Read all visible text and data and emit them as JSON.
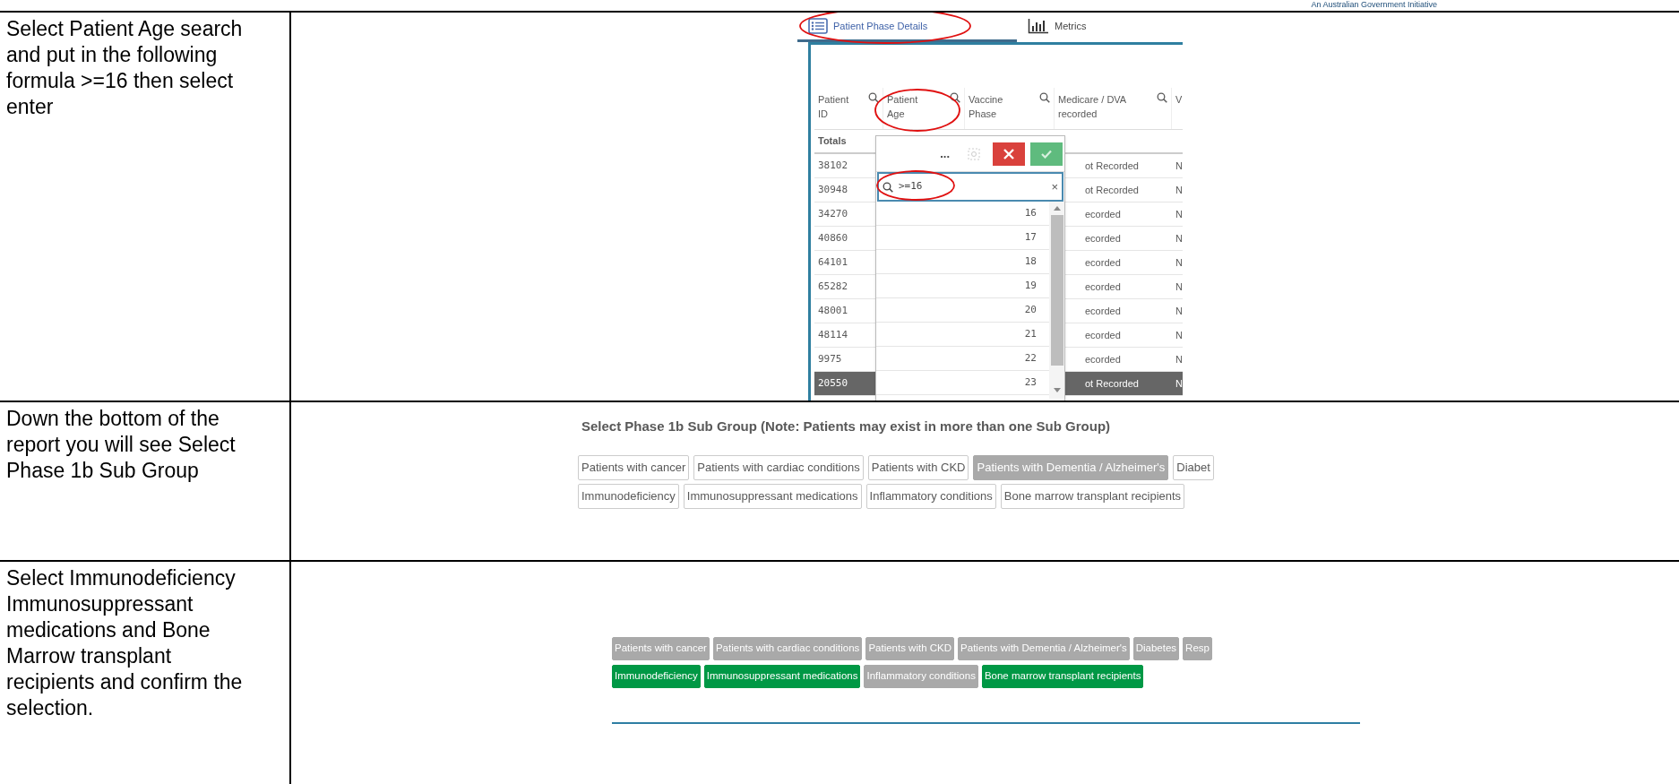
{
  "header_text": "An Australian Government Initiative",
  "steps": [
    {
      "instruction": "Select Patient Age search and put in the following formula >=16 then select enter",
      "screen": {
        "kind": "table_filter",
        "tabs": [
          {
            "label": "Patient Phase Details",
            "selected": true
          },
          {
            "label": "Metrics",
            "selected": false
          }
        ],
        "columns": [
          "Patient ID",
          "Patient Age",
          "Vaccine Phase",
          "Medicare / DVA recorded",
          "V"
        ],
        "totals_label": "Totals",
        "rows": [
          {
            "id": "38102",
            "column_4": "ot Recorded",
            "column_5": "N",
            "selected": false
          },
          {
            "id": "30948",
            "column_4": "ot Recorded",
            "column_5": "N",
            "selected": false
          },
          {
            "id": "34270",
            "column_4": "ecorded",
            "column_5": "N",
            "selected": false
          },
          {
            "id": "40860",
            "column_4": "ecorded",
            "column_5": "N",
            "selected": false
          },
          {
            "id": "64101",
            "column_4": "ecorded",
            "column_5": "N",
            "selected": false
          },
          {
            "id": "65282",
            "column_4": "ecorded",
            "column_5": "N",
            "selected": false
          },
          {
            "id": "48001",
            "column_4": "ecorded",
            "column_5": "N",
            "selected": false
          },
          {
            "id": "48114",
            "column_4": "ecorded",
            "column_5": "N",
            "selected": false
          },
          {
            "id": "9975",
            "column_4": "ecorded",
            "column_5": "N",
            "selected": false
          },
          {
            "id": "20550",
            "column_4": "ot Recorded",
            "column_5": "N",
            "selected": true
          }
        ],
        "popup": {
          "more": "...",
          "search_value": ">=16",
          "clear": "×",
          "values": [
            "16",
            "17",
            "18",
            "19",
            "20",
            "21",
            "22",
            "23"
          ]
        }
      }
    },
    {
      "instruction": "Down the bottom of the report you will see Select Phase 1b Sub Group",
      "screen": {
        "kind": "chip_list",
        "title": "Select Phase 1b Sub Group (Note: Patients may exist in more than one Sub Group)",
        "divider": false,
        "chip_rows": [
          [
            {
              "label": "Patients with cancer",
              "selected": false,
              "greyed": false
            },
            {
              "label": "Patients with cardiac conditions",
              "selected": false,
              "greyed": false
            },
            {
              "label": "Patients with CKD",
              "selected": false,
              "greyed": false
            },
            {
              "label": "Patients with Dementia / Alzheimer's",
              "selected": false,
              "greyed": true
            },
            {
              "label": "Diabet",
              "selected": false,
              "greyed": false
            }
          ],
          [
            {
              "label": "Immunodeficiency",
              "selected": false,
              "greyed": false
            },
            {
              "label": "Immunosuppressant medications",
              "selected": false,
              "greyed": false
            },
            {
              "label": "Inflammatory conditions",
              "selected": false,
              "greyed": false
            },
            {
              "label": "Bone marrow transplant recipients",
              "selected": false,
              "greyed": false
            }
          ]
        ]
      }
    },
    {
      "instruction": "Select Immunodeficiency Immunosuppressant medications and Bone Marrow transplant recipients and confirm the selection.",
      "screen": {
        "kind": "chip_list",
        "divider": true,
        "chip_rows": [
          [
            {
              "label": "Patients with cancer",
              "selected": false,
              "greyed": true
            },
            {
              "label": "Patients with cardiac conditions",
              "selected": false,
              "greyed": true
            },
            {
              "label": "Patients with CKD",
              "selected": false,
              "greyed": true
            },
            {
              "label": "Patients with Dementia / Alzheimer's",
              "selected": false,
              "greyed": true
            },
            {
              "label": "Diabetes",
              "selected": false,
              "greyed": true
            },
            {
              "label": "Resp",
              "selected": false,
              "greyed": true
            }
          ],
          [
            {
              "label": "Immunodeficiency",
              "selected": true
            },
            {
              "label": "Immunosuppressant medications",
              "selected": true
            },
            {
              "label": "Inflammatory conditions",
              "selected": false,
              "greyed": true
            },
            {
              "label": "Bone marrow transplant recipients",
              "selected": true
            }
          ]
        ]
      }
    }
  ]
}
